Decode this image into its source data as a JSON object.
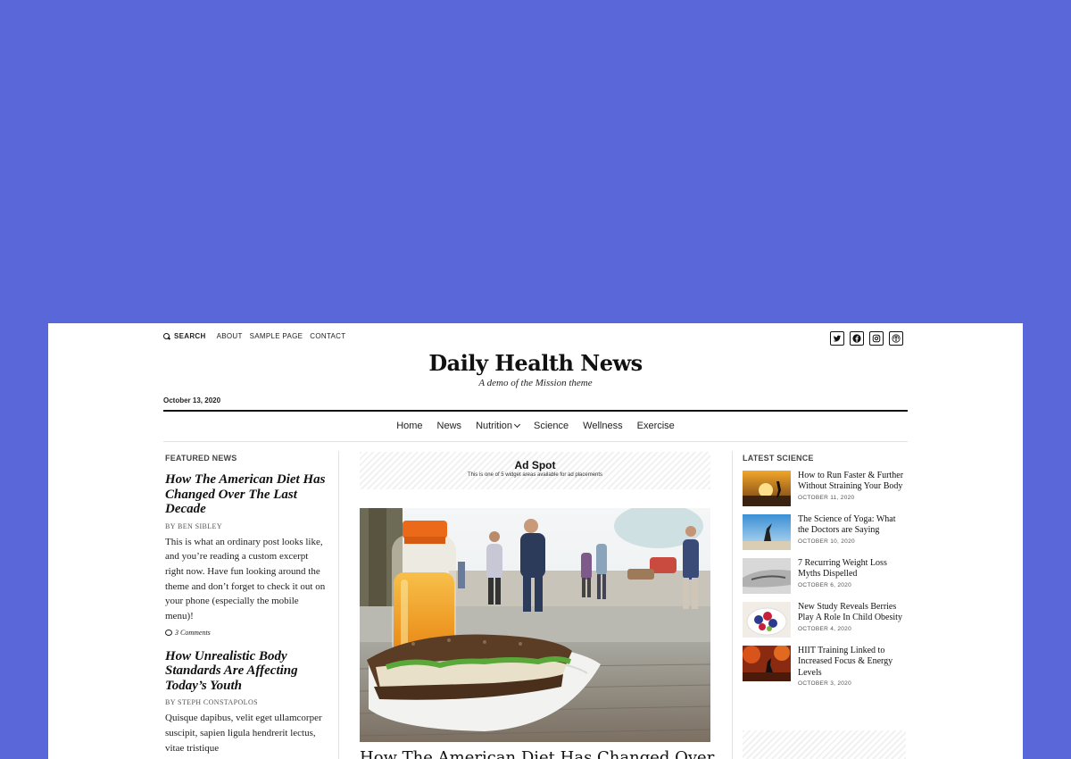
{
  "topbar": {
    "search_label": "SEARCH",
    "links": [
      "ABOUT",
      "SAMPLE PAGE",
      "CONTACT"
    ]
  },
  "social_icons": [
    "twitter-icon",
    "facebook-icon",
    "instagram-icon",
    "podcast-icon"
  ],
  "brand": {
    "title": "Daily Health News",
    "tagline": "A demo of the Mission theme"
  },
  "date": "October 13, 2020",
  "nav": [
    "Home",
    "News",
    "Nutrition",
    "Science",
    "Wellness",
    "Exercise"
  ],
  "featured": {
    "label": "FEATURED NEWS",
    "posts": [
      {
        "title": "How The American Diet Has Changed Over The Last Decade",
        "byline": "BY BEN SIBLEY",
        "excerpt": "This is what an ordinary post looks like, and you’re reading a custom excerpt right now. Have fun looking around the theme and don’t forget to check it out on your phone (especially the mobile menu)!",
        "comments": "3 Comments"
      },
      {
        "title": "How Unrealistic Body Standards Are Affecting Today’s Youth",
        "byline": "BY STEPH CONSTAPOLOS",
        "excerpt": "Quisque dapibus, velit eget ullamcorper suscipit, sapien ligula hendrerit lectus, vitae tristique"
      }
    ]
  },
  "ad": {
    "title": "Ad Spot",
    "subtitle": "This is one of 5 widget areas available for ad placements"
  },
  "main_title": "How The American Diet Has Changed Over",
  "science": {
    "label": "LATEST SCIENCE",
    "items": [
      {
        "title": "How to Run Faster & Further Without Straining Your Body",
        "date": "OCTOBER 11, 2020"
      },
      {
        "title": "The Science of Yoga: What the Doctors are Saying",
        "date": "OCTOBER 10, 2020"
      },
      {
        "title": "7 Recurring Weight Loss Myths Dispelled",
        "date": "OCTOBER 6, 2020"
      },
      {
        "title": "New Study Reveals Berries Play A Role In Child Obesity",
        "date": "OCTOBER 4, 2020"
      },
      {
        "title": "HIIT Training Linked to Increased Focus & Energy Levels",
        "date": "OCTOBER 3, 2020"
      }
    ]
  }
}
